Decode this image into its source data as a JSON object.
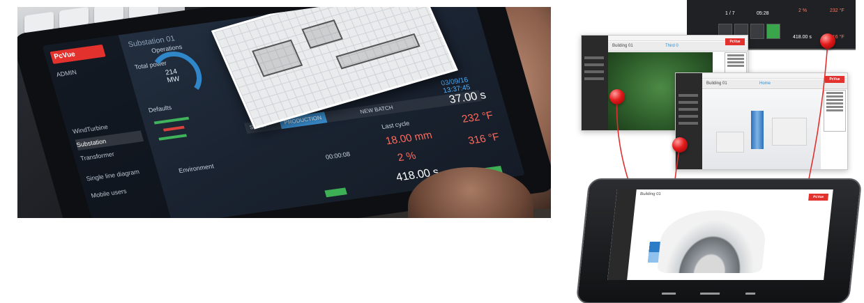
{
  "photo_tablet": {
    "brand_logo": "PcVue",
    "user_label": "ADMIN",
    "page_title": "Substation 01",
    "operations_label": "Operations",
    "total_power_label": "Total power",
    "gauge_value": "214",
    "gauge_unit": "MW",
    "defaults_label": "Defaults",
    "environment_label": "Environment",
    "sidebar_items": [
      "WindTurbine",
      "Substation",
      "Transformer",
      "Single line diagram",
      "Mobile users"
    ],
    "tabs": [
      "SETUP",
      "PRODUCTION",
      "NEW BATCH"
    ],
    "last_cycle_label": "Last cycle",
    "value_18mm": "18.00 mm",
    "value_2pct": "2 %",
    "value_418": "418.00 s",
    "value_37": "37.00 s",
    "value_232": "232 °F",
    "value_316": "316 °F",
    "datetime": "03/09/16 13:37:45",
    "time_readout": "00:00:08"
  },
  "windows": {
    "green_window": {
      "title": "Building 01",
      "tab": "Third 0",
      "badge": "PcVue"
    },
    "white_window": {
      "title": "Building 01",
      "tab": "Home",
      "badge": "PcVue"
    },
    "dark_window": {
      "values": [
        "1 / 7",
        "05:28",
        "2 %",
        "232 °F",
        "418.00 s",
        "316 °F"
      ]
    }
  },
  "big_tablet": {
    "title": "Building 01",
    "badge": "PcVue"
  },
  "colors": {
    "accent_red": "#e41c1c",
    "brand_red": "#e3312d",
    "accent_blue": "#2b8fd6",
    "ok_green": "#3db055"
  }
}
